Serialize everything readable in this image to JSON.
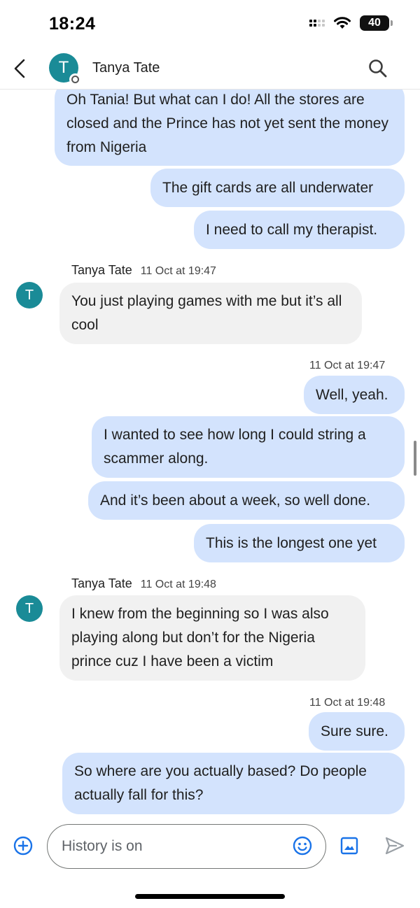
{
  "status_bar": {
    "time": "18:24",
    "battery": "40"
  },
  "header": {
    "avatar_letter": "T",
    "contact_name": "Tanya Tate"
  },
  "messages": [
    {
      "dir": "out",
      "text": "Oh Tania! But what can I do! All the stores are closed and the Prince has not yet sent the money from Nigeria"
    },
    {
      "dir": "out",
      "text": "The gift cards are all underwater"
    },
    {
      "dir": "out",
      "text": "I need to call my therapist."
    },
    {
      "dir": "meta_in",
      "sender": "Tanya Tate",
      "time": "11 Oct at 19:47"
    },
    {
      "dir": "in",
      "avatar": "T",
      "text": "You just playing games with me but it’s all cool"
    },
    {
      "dir": "meta_out",
      "time": "11 Oct at 19:47"
    },
    {
      "dir": "out",
      "text": "Well, yeah."
    },
    {
      "dir": "out",
      "text": "I wanted to see how long I could string a scammer along."
    },
    {
      "dir": "out",
      "text": "And it’s been about a week, so well done."
    },
    {
      "dir": "out",
      "text": "This is the longest one yet"
    },
    {
      "dir": "meta_in",
      "sender": "Tanya Tate",
      "time": "11 Oct at 19:48"
    },
    {
      "dir": "in",
      "avatar": "T",
      "text": "I knew from the beginning so I was also playing along but don’t for the Nigeria prince cuz I have been a victim"
    },
    {
      "dir": "meta_out",
      "time": "11 Oct at 19:48"
    },
    {
      "dir": "out",
      "text": "Sure sure."
    },
    {
      "dir": "out",
      "text": "So where are you actually based? Do people actually fall for this?"
    }
  ],
  "composer": {
    "placeholder": "History is on"
  },
  "icons": {
    "back": "chevron-left-icon",
    "search": "search-icon",
    "add": "add-circle-icon",
    "emoji": "emoji-icon",
    "image": "image-icon",
    "send": "send-icon"
  },
  "colors": {
    "outgoing_bubble": "#d3e3fd",
    "incoming_bubble": "#f1f1f1",
    "avatar": "#1a8b97",
    "accent": "#1a73e8"
  }
}
